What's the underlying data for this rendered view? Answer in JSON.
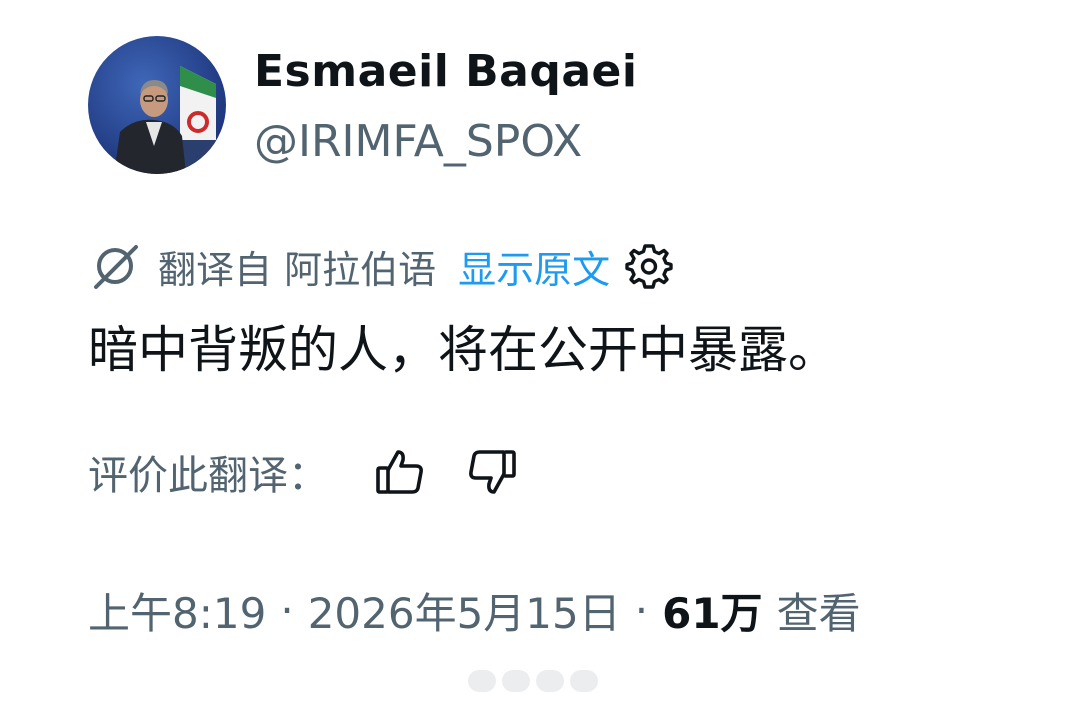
{
  "author": {
    "name": "Esmaeil Baqaei",
    "handle": "@IRIMFA_SPOX"
  },
  "translation": {
    "icon": "translate-icon",
    "label": "翻译自 阿拉伯语",
    "show_original": "显示原文",
    "settings_icon": "gear-icon"
  },
  "tweet": {
    "text": "暗中背叛的人，将在公开中暴露。"
  },
  "rating": {
    "label": "评价此翻译：",
    "like_icon": "thumbs-up-icon",
    "dislike_icon": "thumbs-down-icon"
  },
  "meta": {
    "time": "上午8:19",
    "separator": "·",
    "date": "2026年5月15日",
    "views_count": "61万",
    "views_label": "查看"
  },
  "colors": {
    "text_primary": "#0f1419",
    "text_secondary": "#536471",
    "link": "#1d9bf0"
  }
}
